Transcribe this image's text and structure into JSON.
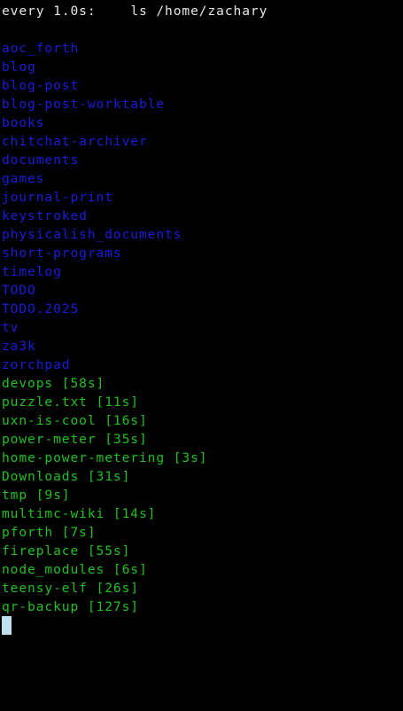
{
  "header": {
    "interval": "every 1.0s:",
    "command": "ls /home/zachary"
  },
  "colors": {
    "directory": "#1c1cd8",
    "entry_with_age": "#20c020",
    "header": "#e6e6e6",
    "cursor": "#bfe0ec",
    "background": "#000000"
  },
  "directories": [
    "aoc_forth",
    "blog",
    "blog-post",
    "blog-post-worktable",
    "books",
    "chitchat-archiver",
    "documents",
    "games",
    "journal-print",
    "keystroked",
    "physicalish_documents",
    "short-programs",
    "timelog",
    "TODO",
    "TODO.2025",
    "tv",
    "za3k",
    "zorchpad"
  ],
  "recent_entries": [
    "devops [58s]",
    "puzzle.txt [11s]",
    "uxn-is-cool [16s]",
    "power-meter [35s]",
    "home-power-metering [3s]",
    "Downloads [31s]",
    "tmp [9s]",
    "multimc-wiki [14s]",
    "pforth [7s]",
    "fireplace [55s]",
    "node_modules [6s]",
    "teensy-elf [26s]",
    "qr-backup [127s]"
  ]
}
